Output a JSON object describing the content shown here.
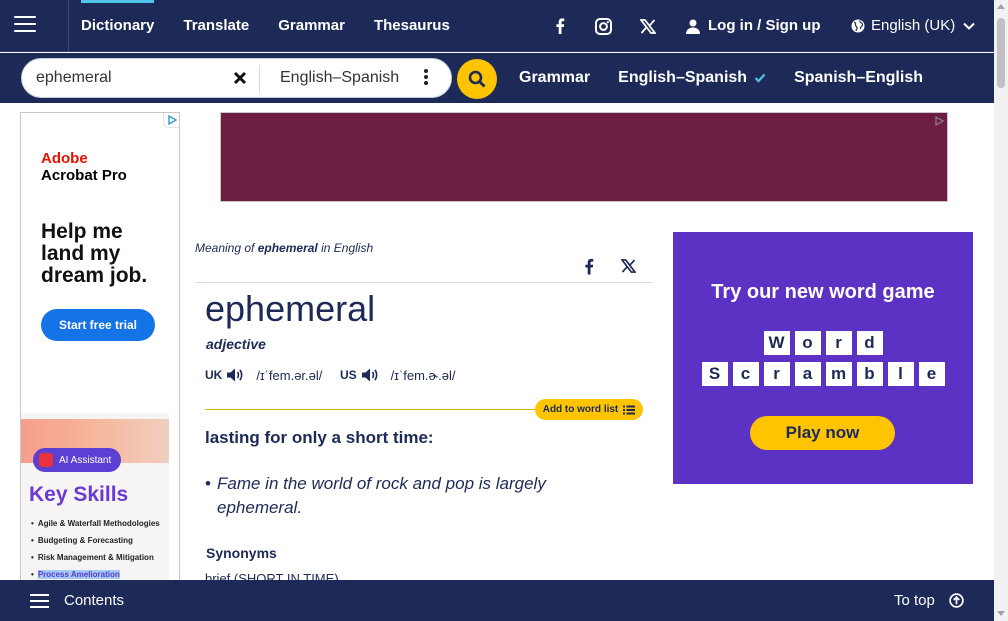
{
  "nav": {
    "menu_icon": "hamburger-icon",
    "links": [
      {
        "label": "Dictionary",
        "active": true
      },
      {
        "label": "Translate"
      },
      {
        "label": "Grammar"
      },
      {
        "label": "Thesaurus"
      }
    ],
    "social_icons": [
      "facebook-icon",
      "instagram-icon",
      "x-icon"
    ],
    "login_label": "Log in / Sign up",
    "language_label": "English (UK)"
  },
  "search": {
    "value": "ephemeral",
    "dictionary": "English–Spanish",
    "sub_links": [
      {
        "label": "Grammar"
      },
      {
        "label": "English–Spanish",
        "checked": true
      },
      {
        "label": "Spanish–English"
      }
    ]
  },
  "ads": {
    "left": {
      "brand": "Adobe",
      "product": "Acrobat Pro",
      "headline": "Help me land my dream job.",
      "cta": "Start free trial",
      "chip": "AI Assistant",
      "section_title": "Key Skills",
      "skills": [
        "Agile & Waterfall Methodologies",
        "Budgeting & Forecasting",
        "Risk Management & Mitigation",
        "Process Amelioration"
      ]
    },
    "game": {
      "title": "Try our new word game",
      "row1": [
        "W",
        "o",
        "r",
        "d"
      ],
      "row2": [
        "S",
        "c",
        "r",
        "a",
        "m",
        "b",
        "l",
        "e"
      ],
      "button": "Play now"
    }
  },
  "entry": {
    "meaning_prefix": "Meaning of",
    "meaning_word": "ephemeral",
    "meaning_suffix": "in English",
    "headword": "ephemeral",
    "pos": "adjective",
    "uk_label": "UK",
    "uk_ipa": "/ɪˈfem.ər.əl/",
    "us_label": "US",
    "us_ipa": "/ɪˈfem.ɚ.əl/",
    "add_to_list": "Add to word list",
    "definition": "lasting for only a short time:",
    "example": "Fame in the world of rock and pop is largely ephemeral.",
    "synonyms_heading": "Synonyms",
    "synonym_first": "brief (SHORT IN TIME)"
  },
  "bottom": {
    "contents_label": "Contents",
    "to_top_label": "To top"
  },
  "colors": {
    "navy": "#1d2a57",
    "accent_yellow": "#fec400",
    "game_purple": "#5b32c4",
    "banner_maroon": "#6d1d3f"
  }
}
